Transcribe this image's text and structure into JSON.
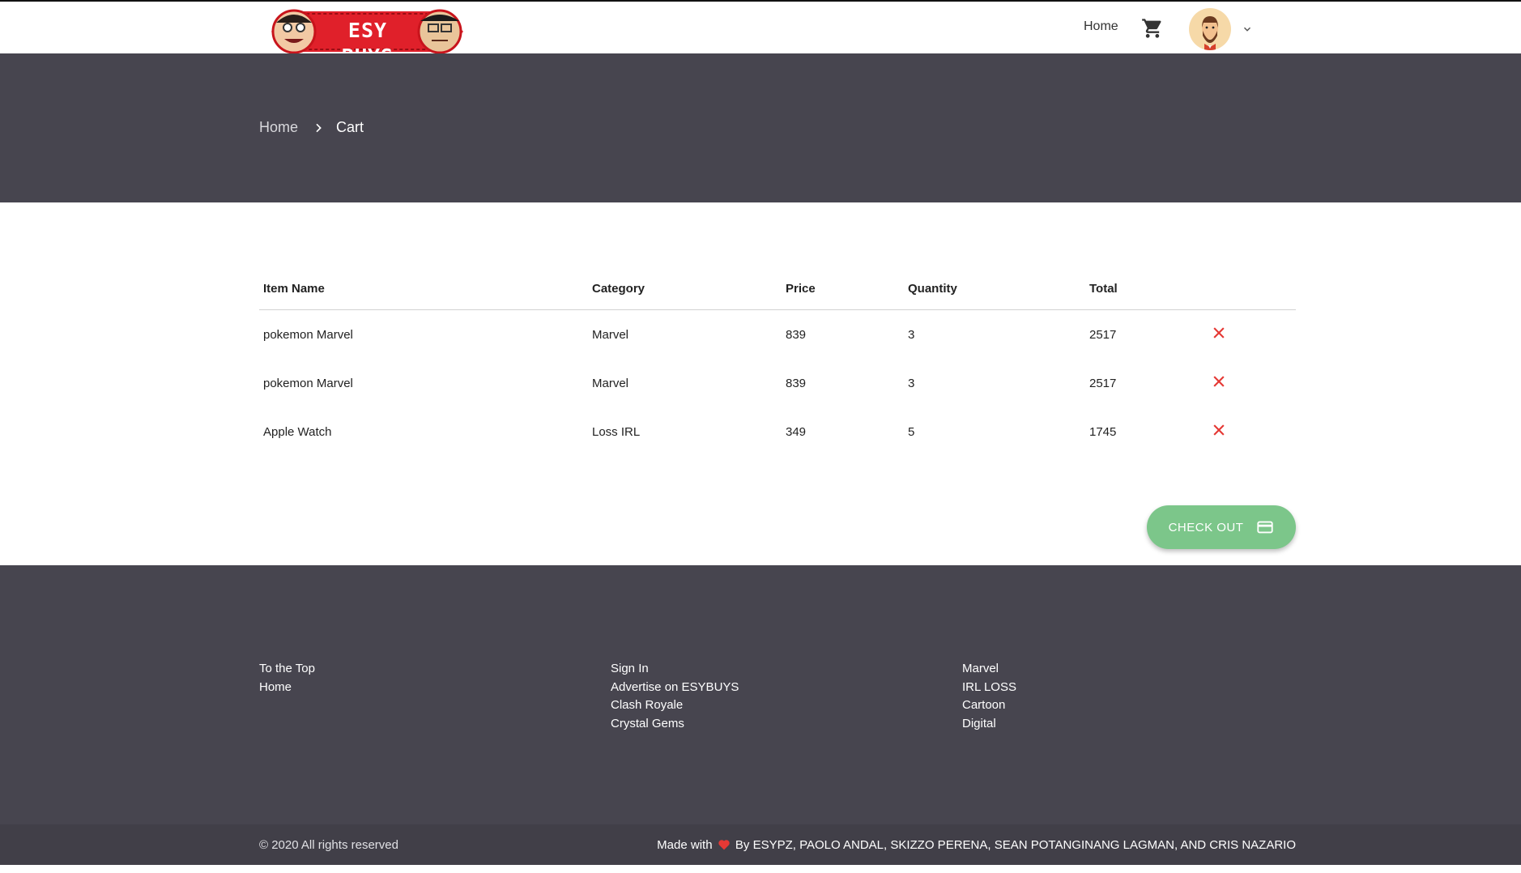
{
  "header": {
    "logo_text": "ESY BUYS",
    "nav_home": "Home",
    "icons": [
      "shopping-cart-icon",
      "avatar",
      "chevron-down-icon"
    ]
  },
  "breadcrumb": {
    "home": "Home",
    "current": "Cart"
  },
  "cart": {
    "columns": [
      "Item Name",
      "Category",
      "Price",
      "Quantity",
      "Total"
    ],
    "rows": [
      {
        "name": "pokemon Marvel",
        "category": "Marvel",
        "price": "839",
        "quantity": "3",
        "total": "2517"
      },
      {
        "name": "pokemon Marvel",
        "category": "Marvel",
        "price": "839",
        "quantity": "3",
        "total": "2517"
      },
      {
        "name": "Apple Watch",
        "category": "Loss IRL",
        "price": "349",
        "quantity": "5",
        "total": "1745"
      }
    ],
    "checkout_label": "CHECK OUT"
  },
  "footer": {
    "col1": [
      "To the Top",
      "Home"
    ],
    "col2": [
      "Sign In",
      "Advertise on ESYBUYS",
      "Clash Royale",
      "Crystal Gems"
    ],
    "col3": [
      "Marvel",
      "IRL LOSS",
      "Cartoon",
      "Digital"
    ],
    "copyright": "© 2020 All rights reserved",
    "credits_prefix": "Made with",
    "credits_suffix": "By ESYPZ, PAOLO ANDAL, SKIZZO PERENA, SEAN POTANGINANG LAGMAN, AND CRIS NAZARIO"
  },
  "colors": {
    "hero": "#47454f",
    "checkout": "#7cc68a",
    "delete": "#e53935",
    "logo_red": "#e0202a"
  }
}
